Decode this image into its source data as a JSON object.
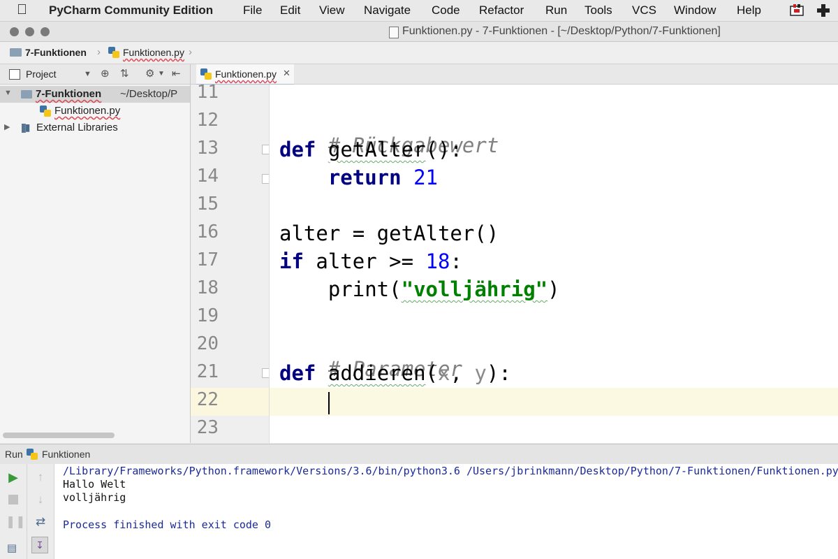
{
  "menubar": {
    "app_name": "PyCharm Community Edition",
    "items": [
      "File",
      "Edit",
      "View",
      "Navigate",
      "Code",
      "Refactor",
      "Run",
      "Tools",
      "VCS",
      "Window",
      "Help"
    ]
  },
  "window": {
    "title": "Funktionen.py - 7-Funktionen - [~/Desktop/Python/7-Funktionen]"
  },
  "navbar": {
    "project": "7-Funktionen",
    "file": "Funktionen.py"
  },
  "project_panel": {
    "label": "Project",
    "root_name": "7-Funktionen",
    "root_path": "~/Desktop/P",
    "file": "Funktionen.py",
    "libraries": "External Libraries"
  },
  "editor": {
    "tab_label": "Funktionen.py",
    "line_numbers": [
      "11",
      "12",
      "13",
      "14",
      "15",
      "16",
      "17",
      "18",
      "19",
      "20",
      "21",
      "22",
      "23"
    ],
    "code": {
      "l12": "# Rückgabewert",
      "l13_kw": "def",
      "l13_name": "getAlter",
      "l13_rest": "():",
      "l14_kw": "return",
      "l14_num": "21",
      "l16": "alter = getAlter()",
      "l17_kw": "if",
      "l17_mid": " alter >= ",
      "l17_num": "18",
      "l17_end": ":",
      "l18_fn": "print(",
      "l18_str": "\"volljährig\"",
      "l18_end": ")",
      "l20": "# Parameter",
      "l21_kw": "def",
      "l21_name": "addieren",
      "l21_open": "(",
      "l21_x": "x",
      "l21_comma": ", ",
      "l21_y": "y",
      "l21_end": "):"
    }
  },
  "run_panel": {
    "label": "Run",
    "config_name": "Funktionen",
    "console": [
      "/Library/Frameworks/Python.framework/Versions/3.6/bin/python3.6 /Users/jbrinkmann/Desktop/Python/7-Funktionen/Funktionen.py",
      "Hallo Welt",
      "volljährig",
      "",
      "Process finished with exit code 0"
    ]
  },
  "colors": {
    "keyword": "#000080",
    "number": "#0000ff",
    "string": "#008000",
    "comment": "#808080",
    "run_green": "#3a9a3a"
  }
}
